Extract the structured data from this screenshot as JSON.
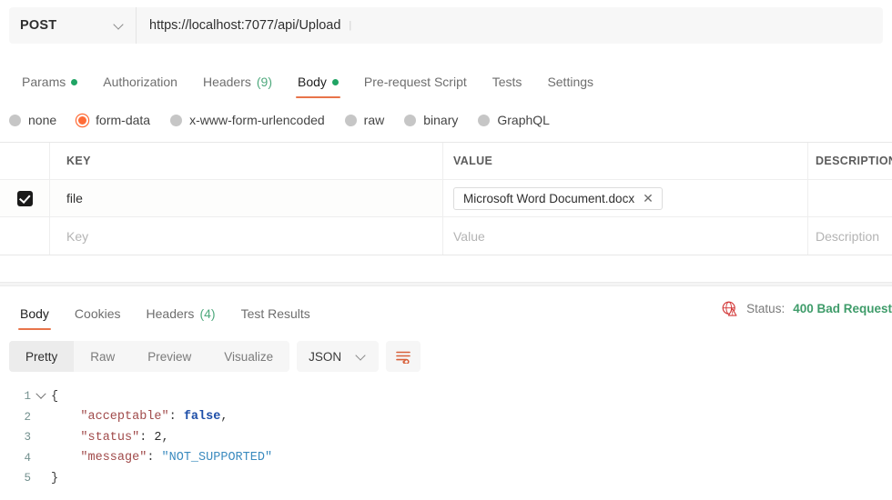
{
  "request": {
    "method": "POST",
    "url": "https://localhost:7077/api/Upload",
    "tabs": [
      {
        "label": "Params",
        "dot": true,
        "active": false
      },
      {
        "label": "Authorization",
        "dot": false,
        "active": false
      },
      {
        "label": "Headers",
        "count": "(9)",
        "dot": false,
        "active": false
      },
      {
        "label": "Body",
        "dot": true,
        "active": true
      },
      {
        "label": "Pre-request Script",
        "dot": false,
        "active": false
      },
      {
        "label": "Tests",
        "dot": false,
        "active": false
      },
      {
        "label": "Settings",
        "dot": false,
        "active": false
      }
    ],
    "body_types": [
      {
        "label": "none",
        "selected": false
      },
      {
        "label": "form-data",
        "selected": true
      },
      {
        "label": "x-www-form-urlencoded",
        "selected": false
      },
      {
        "label": "raw",
        "selected": false
      },
      {
        "label": "binary",
        "selected": false
      },
      {
        "label": "GraphQL",
        "selected": false
      }
    ],
    "table": {
      "headers": {
        "key": "KEY",
        "value": "VALUE",
        "description": "DESCRIPTION"
      },
      "rows": [
        {
          "checked": true,
          "key": "file",
          "value_file": "Microsoft Word Document.docx",
          "remove": "✕",
          "description": ""
        }
      ],
      "placeholders": {
        "key": "Key",
        "value": "Value",
        "description": "Description"
      }
    }
  },
  "response": {
    "tabs": [
      {
        "label": "Body",
        "active": true
      },
      {
        "label": "Cookies",
        "active": false
      },
      {
        "label": "Headers",
        "count": "(4)",
        "active": false
      },
      {
        "label": "Test Results",
        "active": false
      }
    ],
    "status_label": "Status:",
    "status_value": "400 Bad Request",
    "formats": [
      {
        "label": "Pretty",
        "active": true
      },
      {
        "label": "Raw",
        "active": false
      },
      {
        "label": "Preview",
        "active": false
      },
      {
        "label": "Visualize",
        "active": false
      }
    ],
    "language": "JSON",
    "body_lines": [
      {
        "num": "1",
        "fold": true,
        "segments": [
          {
            "t": "{",
            "c": "punc"
          }
        ],
        "indent": 0
      },
      {
        "num": "2",
        "fold": false,
        "segments": [
          {
            "t": "\"acceptable\"",
            "c": "k"
          },
          {
            "t": ": ",
            "c": "punc"
          },
          {
            "t": "false",
            "c": "bool"
          },
          {
            "t": ",",
            "c": "punc"
          }
        ],
        "indent": 1
      },
      {
        "num": "3",
        "fold": false,
        "segments": [
          {
            "t": "\"status\"",
            "c": "k"
          },
          {
            "t": ": ",
            "c": "punc"
          },
          {
            "t": "2",
            "c": "num"
          },
          {
            "t": ",",
            "c": "punc"
          }
        ],
        "indent": 1
      },
      {
        "num": "4",
        "fold": false,
        "segments": [
          {
            "t": "\"message\"",
            "c": "k"
          },
          {
            "t": ": ",
            "c": "punc"
          },
          {
            "t": "\"NOT_SUPPORTED\"",
            "c": "str"
          }
        ],
        "indent": 1
      },
      {
        "num": "5",
        "fold": false,
        "segments": [
          {
            "t": "}",
            "c": "punc"
          }
        ],
        "indent": 0
      }
    ]
  },
  "colors": {
    "accent": "#ff6c37",
    "tab_underline": "#e8744a",
    "dot_green": "#20a464",
    "status_green": "#3f9c6a",
    "status_icon_red": "#d33a3a"
  }
}
